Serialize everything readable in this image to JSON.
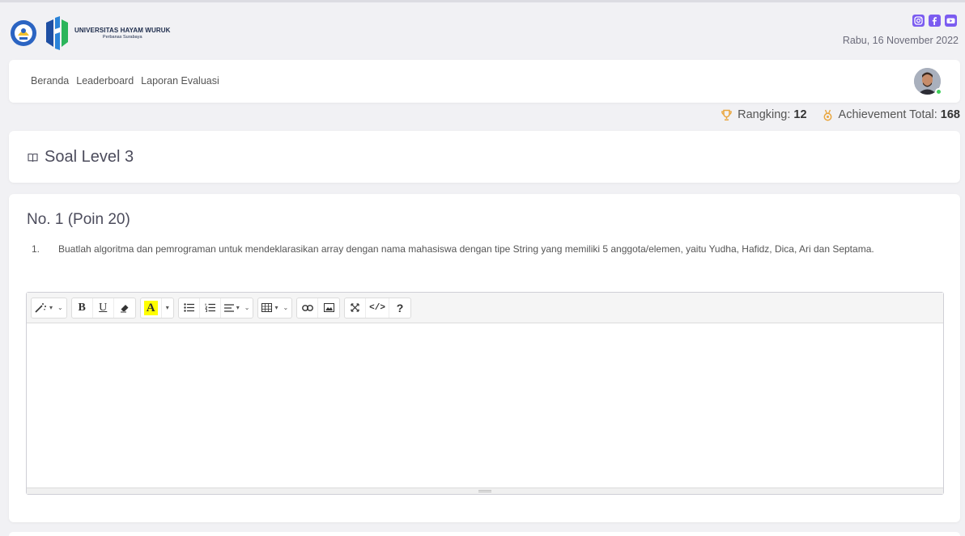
{
  "header": {
    "logo_line1": "UNIVERSITAS HAYAM WURUK",
    "logo_line2": "Perbanas Surabaya",
    "date": "Rabu, 16 November 2022",
    "socials": [
      "instagram-icon",
      "facebook-icon",
      "youtube-icon"
    ]
  },
  "nav": {
    "links": [
      "Beranda",
      "Leaderboard",
      "Laporan Evaluasi"
    ]
  },
  "stats": {
    "rank_label": "Rangking:",
    "rank_value": "12",
    "achievement_label": "Achievement Total:",
    "achievement_value": "168"
  },
  "level": {
    "title": "Soal Level 3"
  },
  "question": {
    "title": "No. 1 (Poin 20)",
    "number": "1.",
    "text": "Buatlah algoritma dan pemrograman untuk mendeklarasikan array dengan nama mahasiswa dengan tipe String yang memiliki 5 anggota/elemen, yaitu Yudha, Hafidz, Dica, Ari dan Septama."
  },
  "editor": {
    "content": "",
    "help_label": "?"
  },
  "colors": {
    "accent": "#7b5cf0",
    "trophy": "#e9a53c",
    "online": "#3ecf5a",
    "highlight": "#ffff00"
  }
}
